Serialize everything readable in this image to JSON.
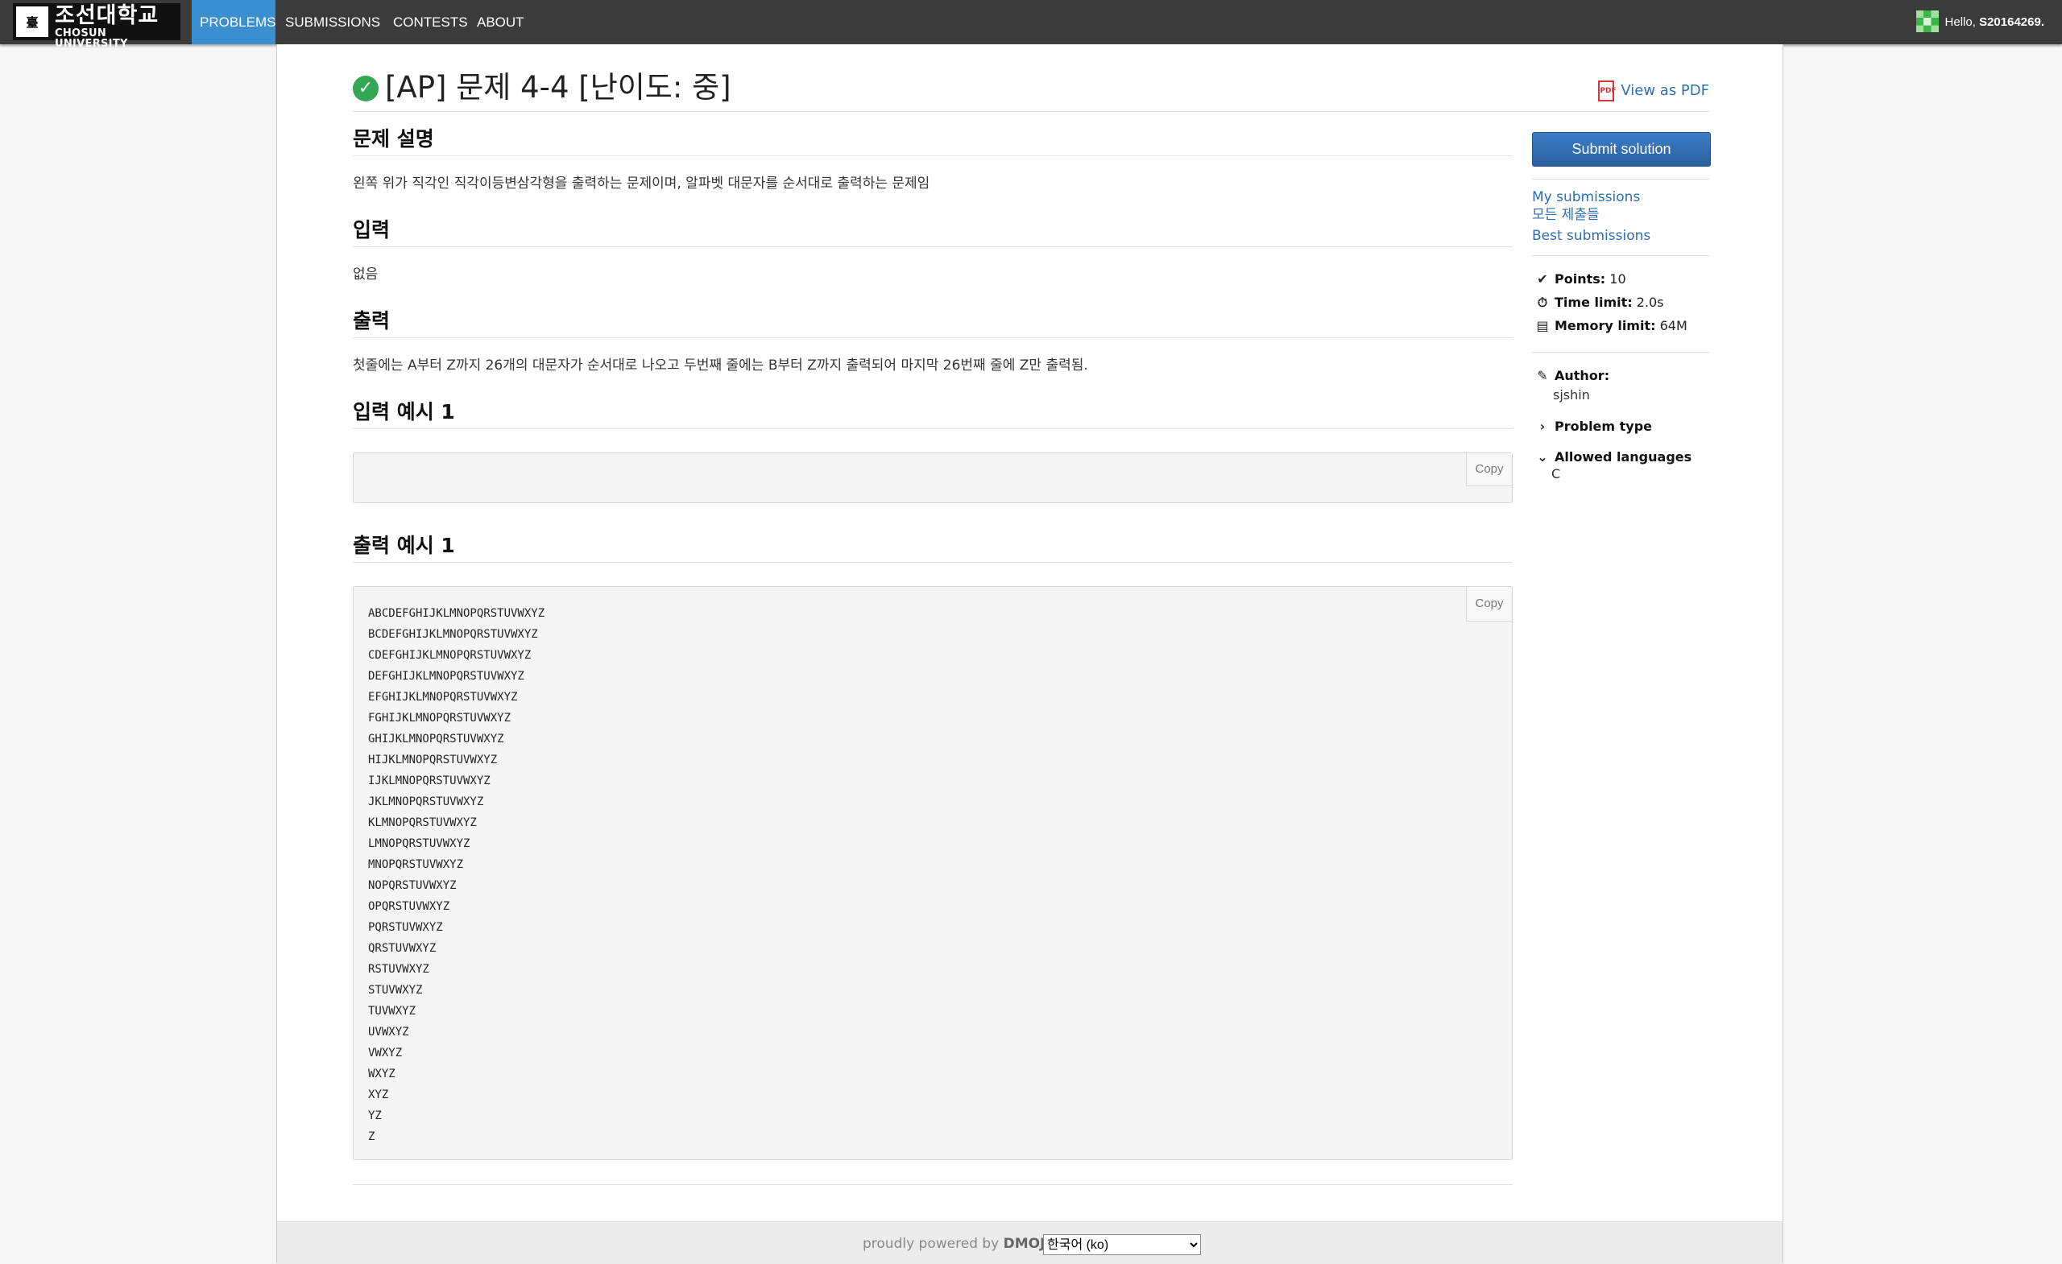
{
  "navbar": {
    "logo_text_ko": "조선대학교",
    "logo_text_en": "CHOSUN UNIVERSITY",
    "logo_emblem": "臺",
    "items": [
      {
        "label": "PROBLEMS",
        "active": true
      },
      {
        "label": "SUBMISSIONS",
        "active": false
      },
      {
        "label": "CONTESTS",
        "active": false
      },
      {
        "label": "ABOUT",
        "active": false
      }
    ],
    "greeting": "Hello,",
    "username": "S20164269.",
    "active_color": "#3b8ecf"
  },
  "problem": {
    "title": "[AP] 문제 4-4 [난이도: 중]",
    "solved_icon": "check-circle-icon",
    "pdf_label": "View as PDF",
    "pdf_icon_text": "PDF",
    "sections": {
      "description_heading": "문제 설명",
      "description": "왼쪽 위가 직각인 직각이등변삼각형을 출력하는 문제이며, 알파벳 대문자를 순서대로 출력하는 문제임",
      "input_heading": "입력",
      "input": "없음",
      "output_heading": "출력",
      "output": "첫줄에는 A부터 Z까지 26개의 대문자가 순서대로 나오고 두번째 줄에는 B부터 Z까지 출력되어 마지막 26번째 줄에 Z만 출력됨.",
      "sample_input_heading": "입력 예시 1",
      "sample_input": "",
      "sample_output_heading": "출력 예시 1",
      "sample_output": [
        "ABCDEFGHIJKLMNOPQRSTUVWXYZ",
        "BCDEFGHIJKLMNOPQRSTUVWXYZ",
        "CDEFGHIJKLMNOPQRSTUVWXYZ",
        "DEFGHIJKLMNOPQRSTUVWXYZ",
        "EFGHIJKLMNOPQRSTUVWXYZ",
        "FGHIJKLMNOPQRSTUVWXYZ",
        "GHIJKLMNOPQRSTUVWXYZ",
        "HIJKLMNOPQRSTUVWXYZ",
        "IJKLMNOPQRSTUVWXYZ",
        "JKLMNOPQRSTUVWXYZ",
        "KLMNOPQRSTUVWXYZ",
        "LMNOPQRSTUVWXYZ",
        "MNOPQRSTUVWXYZ",
        "NOPQRSTUVWXYZ",
        "OPQRSTUVWXYZ",
        "PQRSTUVWXYZ",
        "QRSTUVWXYZ",
        "RSTUVWXYZ",
        "STUVWXYZ",
        "TUVWXYZ",
        "UVWXYZ",
        "VWXYZ",
        "WXYZ",
        "XYZ",
        "YZ",
        "Z"
      ],
      "copy_label": "Copy"
    }
  },
  "sidebar": {
    "submit_label": "Submit solution",
    "links": {
      "my_submissions": "My submissions",
      "all_submissions": "모든 제출들",
      "best_submissions": "Best submissions"
    },
    "info": {
      "points_label": "Points:",
      "points_value": "10",
      "time_label": "Time limit:",
      "time_value": "2.0s",
      "memory_label": "Memory limit:",
      "memory_value": "64M",
      "author_label": "Author:",
      "author_value": "sjshin",
      "problem_type_label": "Problem type",
      "languages_label": "Allowed languages",
      "languages_value": "C"
    },
    "icons": {
      "points": "check-icon",
      "time": "clock-icon",
      "memory": "memory-icon",
      "author": "edit-icon",
      "problem_type": "chevron-right-icon",
      "languages": "chevron-down-icon"
    }
  },
  "footer": {
    "text": "proudly powered by",
    "brand": "DMOJ",
    "separator": "|",
    "language_selected": "한국어 (ko)"
  }
}
